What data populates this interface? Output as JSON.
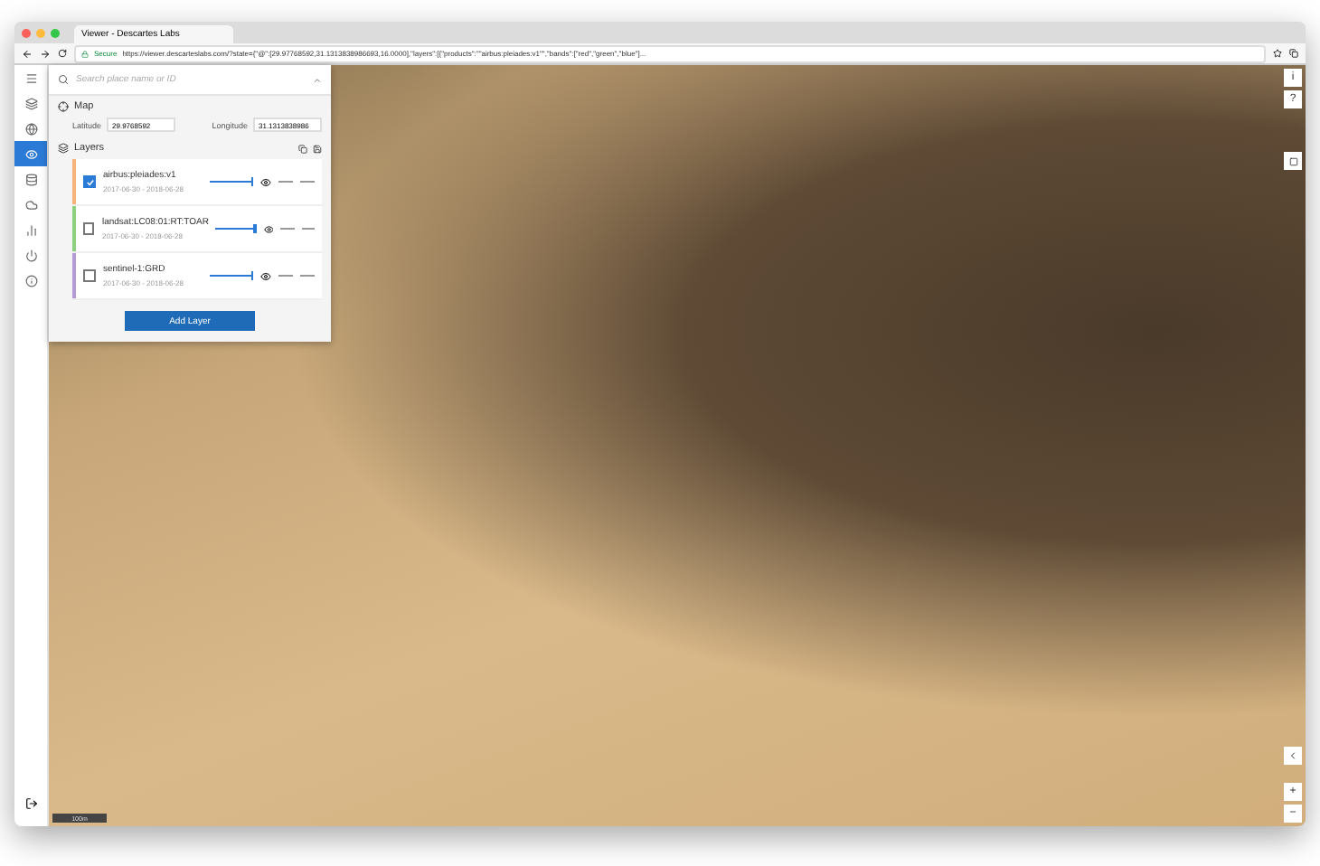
{
  "browser": {
    "tab_title": "Viewer - Descartes Labs",
    "secure_label": "Secure",
    "url": "https://viewer.descarteslabs.com/?state={\"@\":[29.97768592,31.1313838986693,16.0000],\"layers\":[{\"products\":\"\"airbus:pleiades:v1\"\",\"bands\":[\"red\",\"green\",\"blue\"]..."
  },
  "search": {
    "placeholder": "Search place name or ID"
  },
  "rail": [
    {
      "selected": false
    },
    {
      "selected": false
    },
    {
      "selected": true
    },
    {
      "selected": false
    },
    {
      "selected": false
    },
    {
      "selected": false
    },
    {
      "selected": false
    },
    {
      "selected": false
    }
  ],
  "map_section": {
    "title": "Map",
    "latitude_label": "Latitude",
    "latitude": "29.9768592",
    "longitude_label": "Longitude",
    "longitude": "31.1313838986"
  },
  "layers_section": {
    "title": "Layers",
    "add_button": "Add Layer"
  },
  "layers": [
    {
      "name": "airbus:pleiades:v1",
      "dates": "2017-06-30 - 2018-06-28",
      "checked": true,
      "color": "#f5b27a",
      "level": 1.0
    },
    {
      "name": "landsat:LC08:01:RT:TOAR",
      "dates": "2017-06-30 - 2018-06-28",
      "checked": false,
      "color": "#8ccf7e",
      "level": 1.0
    },
    {
      "name": "sentinel-1:GRD",
      "dates": "2017-06-30 - 2018-06-28",
      "checked": false,
      "color": "#b49ad6",
      "level": 1.0
    }
  ],
  "map_controls": {
    "info": "i",
    "help": "?",
    "zoom_in": "+",
    "zoom_out": "−"
  },
  "scale_bar": {
    "label": "100m"
  }
}
